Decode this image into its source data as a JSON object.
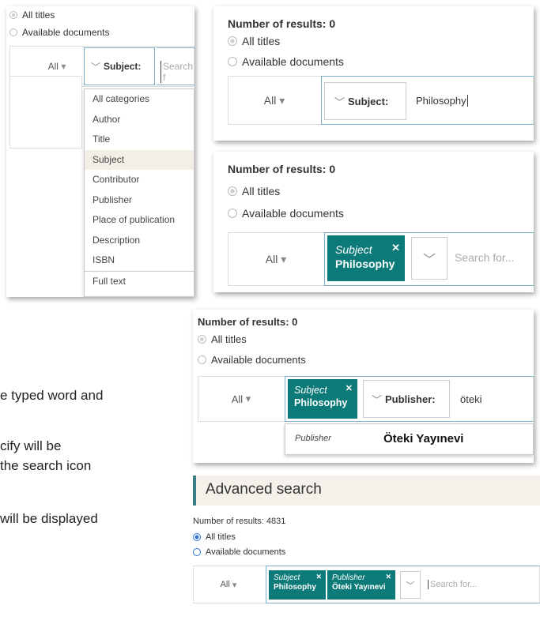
{
  "panel1": {
    "radio_all": "All titles",
    "radio_available": "Available documents",
    "all_label": "All",
    "field_label": "Subject:",
    "search_placeholder": "Search f",
    "menu": [
      "All categories",
      "Author",
      "Title",
      "Subject",
      "Contributor",
      "Publisher",
      "Place of publication",
      "Description",
      "ISBN",
      "Full text"
    ],
    "selected_item": "Subject"
  },
  "panel2": {
    "results": "Number of results: 0",
    "radio_all": "All titles",
    "radio_available": "Available documents",
    "all_label": "All",
    "field_label": "Subject:",
    "input_value": "Philosophy"
  },
  "panel3": {
    "results": "Number of results: 0",
    "radio_all": "All titles",
    "radio_available": "Available documents",
    "all_label": "All",
    "tag_type": "Subject",
    "tag_value": "Philosophy",
    "search_placeholder": "Search for..."
  },
  "panel4": {
    "results": "Number of results: 0",
    "radio_all": "All titles",
    "radio_available": "Available documents",
    "all_label": "All",
    "tag_type": "Subject",
    "tag_value": "Philosophy",
    "field_label": "Publisher:",
    "input_value": "öteki",
    "suggestion_type": "Publisher",
    "suggestion_value": "Öteki Yayınevi"
  },
  "panel5": {
    "heading": "Advanced search",
    "results": "Number of results: 4831",
    "radio_all": "All titles",
    "radio_available": "Available documents",
    "all_label": "All",
    "tag1_type": "Subject",
    "tag1_value": "Philosophy",
    "tag2_type": "Publisher",
    "tag2_value": "Öteki Yayınevi",
    "search_placeholder": "Search for..."
  },
  "body_text": {
    "line1": "e typed word and",
    "line2": "cify will be",
    "line3": "the search icon",
    "line4": "will be displayed"
  }
}
